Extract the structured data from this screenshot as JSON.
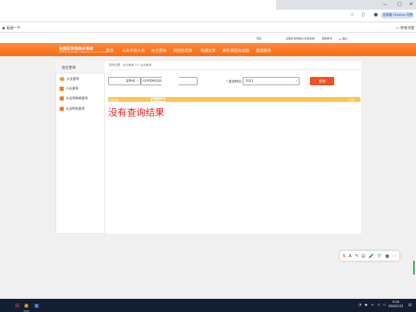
{
  "browser": {
    "back_label": "后退一下",
    "bookmarks_label": "所有书签",
    "profile_label": "在新版 Chrome 可用"
  },
  "site": {
    "top_links": [
      "您好",
      "全国反洗钱统计信息系统",
      "我的账号",
      "退出"
    ],
    "logo_cn": "全国反洗钱统计系统",
    "logo_en": "NATIONAL ANTI-MONEY LAUNDERING STATISTICAL SYSTEM",
    "nav": [
      "首页",
      "从业不良人员",
      "自主查询",
      "风险防范类",
      "沟通交流",
      "案件调查及追踪",
      "增值服务"
    ]
  },
  "sidebar": {
    "title": "自主查询",
    "items": [
      "从业查询",
      "人员查询",
      "从业资格类查询",
      "从业机构查询"
    ]
  },
  "main": {
    "breadcrumb": "您的位置：自主查询 >> 从业查询",
    "select_type": "证件号",
    "id_value": "LVYPDM1D4",
    "time_label": "* 查询时间：",
    "time_value": "2023",
    "query_button": "查询",
    "result_bar_title": "查询结果",
    "result_bar_link": "查看统计",
    "result_total": "共0条",
    "no_result": "没有查询结果"
  },
  "float_toolbar": [
    "S",
    "A",
    "↰",
    "☺",
    "🎤",
    "👕",
    "▦",
    "⋯"
  ],
  "taskbar": {
    "time": "9:44",
    "date": "2024/1/21"
  },
  "colors": {
    "nav_orange": "#f46c15",
    "query_button": "#f0501d",
    "result_bar": "#ffc54d",
    "no_result_text": "#ee1c1c"
  }
}
